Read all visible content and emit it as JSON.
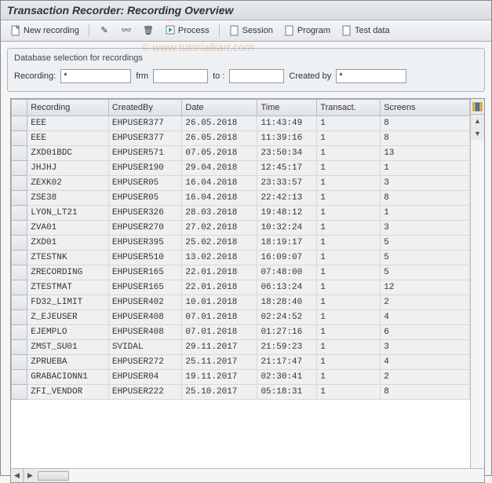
{
  "title": "Transaction Recorder: Recording Overview",
  "watermark": "© www.tutorialkart.com",
  "toolbar": {
    "new_recording": "New recording",
    "process": "Process",
    "session": "Session",
    "program": "Program",
    "test_data": "Test data"
  },
  "filter": {
    "panel_title": "Database selection for recordings",
    "recording_label": "Recording:",
    "recording_value": "*",
    "frm_label": "frm",
    "frm_value": "",
    "to_label": "to  :",
    "to_value": "",
    "created_by_label": "Created by",
    "created_by_value": "*"
  },
  "columns": {
    "recording": "Recording",
    "created_by": "CreatedBy",
    "date": "Date",
    "time": "Time",
    "transact": "Transact.",
    "screens": "Screens"
  },
  "rows": [
    {
      "rec": "EEE",
      "by": "EHPUSER377",
      "date": "26.05.2018",
      "time": "11:43:49",
      "tr": "1",
      "sc": "8"
    },
    {
      "rec": "EEE",
      "by": "EHPUSER377",
      "date": "26.05.2018",
      "time": "11:39:16",
      "tr": "1",
      "sc": "8"
    },
    {
      "rec": "ZXD01BDC",
      "by": "EHPUSER571",
      "date": "07.05.2018",
      "time": "23:50:34",
      "tr": "1",
      "sc": "13"
    },
    {
      "rec": "JHJHJ",
      "by": "EHPUSER190",
      "date": "29.04.2018",
      "time": "12:45:17",
      "tr": "1",
      "sc": "1"
    },
    {
      "rec": "ZEXK02",
      "by": "EHPUSER05",
      "date": "16.04.2018",
      "time": "23:33:57",
      "tr": "1",
      "sc": "3"
    },
    {
      "rec": "ZSE38",
      "by": "EHPUSER05",
      "date": "16.04.2018",
      "time": "22:42:13",
      "tr": "1",
      "sc": "8"
    },
    {
      "rec": "LYON_LT21",
      "by": "EHPUSER326",
      "date": "28.03.2018",
      "time": "19:48:12",
      "tr": "1",
      "sc": "1"
    },
    {
      "rec": "ZVA01",
      "by": "EHPUSER270",
      "date": "27.02.2018",
      "time": "10:32:24",
      "tr": "1",
      "sc": "3"
    },
    {
      "rec": "ZXD01",
      "by": "EHPUSER395",
      "date": "25.02.2018",
      "time": "18:19:17",
      "tr": "1",
      "sc": "5"
    },
    {
      "rec": "ZTESTNK",
      "by": "EHPUSER510",
      "date": "13.02.2018",
      "time": "16:09:07",
      "tr": "1",
      "sc": "5"
    },
    {
      "rec": "ZRECORDING",
      "by": "EHPUSER165",
      "date": "22.01.2018",
      "time": "07:48:00",
      "tr": "1",
      "sc": "5"
    },
    {
      "rec": "ZTESTMAT",
      "by": "EHPUSER165",
      "date": "22.01.2018",
      "time": "06:13:24",
      "tr": "1",
      "sc": "12"
    },
    {
      "rec": "FD32_LIMIT",
      "by": "EHPUSER402",
      "date": "10.01.2018",
      "time": "18:28:40",
      "tr": "1",
      "sc": "2"
    },
    {
      "rec": "Z_EJEUSER",
      "by": "EHPUSER408",
      "date": "07.01.2018",
      "time": "02:24:52",
      "tr": "1",
      "sc": "4"
    },
    {
      "rec": "EJEMPLO",
      "by": "EHPUSER408",
      "date": "07.01.2018",
      "time": "01:27:16",
      "tr": "1",
      "sc": "6"
    },
    {
      "rec": "ZMST_SU01",
      "by": "SVIDAL",
      "date": "29.11.2017",
      "time": "21:59:23",
      "tr": "1",
      "sc": "3"
    },
    {
      "rec": "ZPRUEBA",
      "by": "EHPUSER272",
      "date": "25.11.2017",
      "time": "21:17:47",
      "tr": "1",
      "sc": "4"
    },
    {
      "rec": "GRABACIONN1",
      "by": "EHPUSER04",
      "date": "19.11.2017",
      "time": "02:30:41",
      "tr": "1",
      "sc": "2"
    },
    {
      "rec": "ZFI_VENDOR",
      "by": "EHPUSER222",
      "date": "25.10.2017",
      "time": "05:18:31",
      "tr": "1",
      "sc": "8"
    }
  ]
}
